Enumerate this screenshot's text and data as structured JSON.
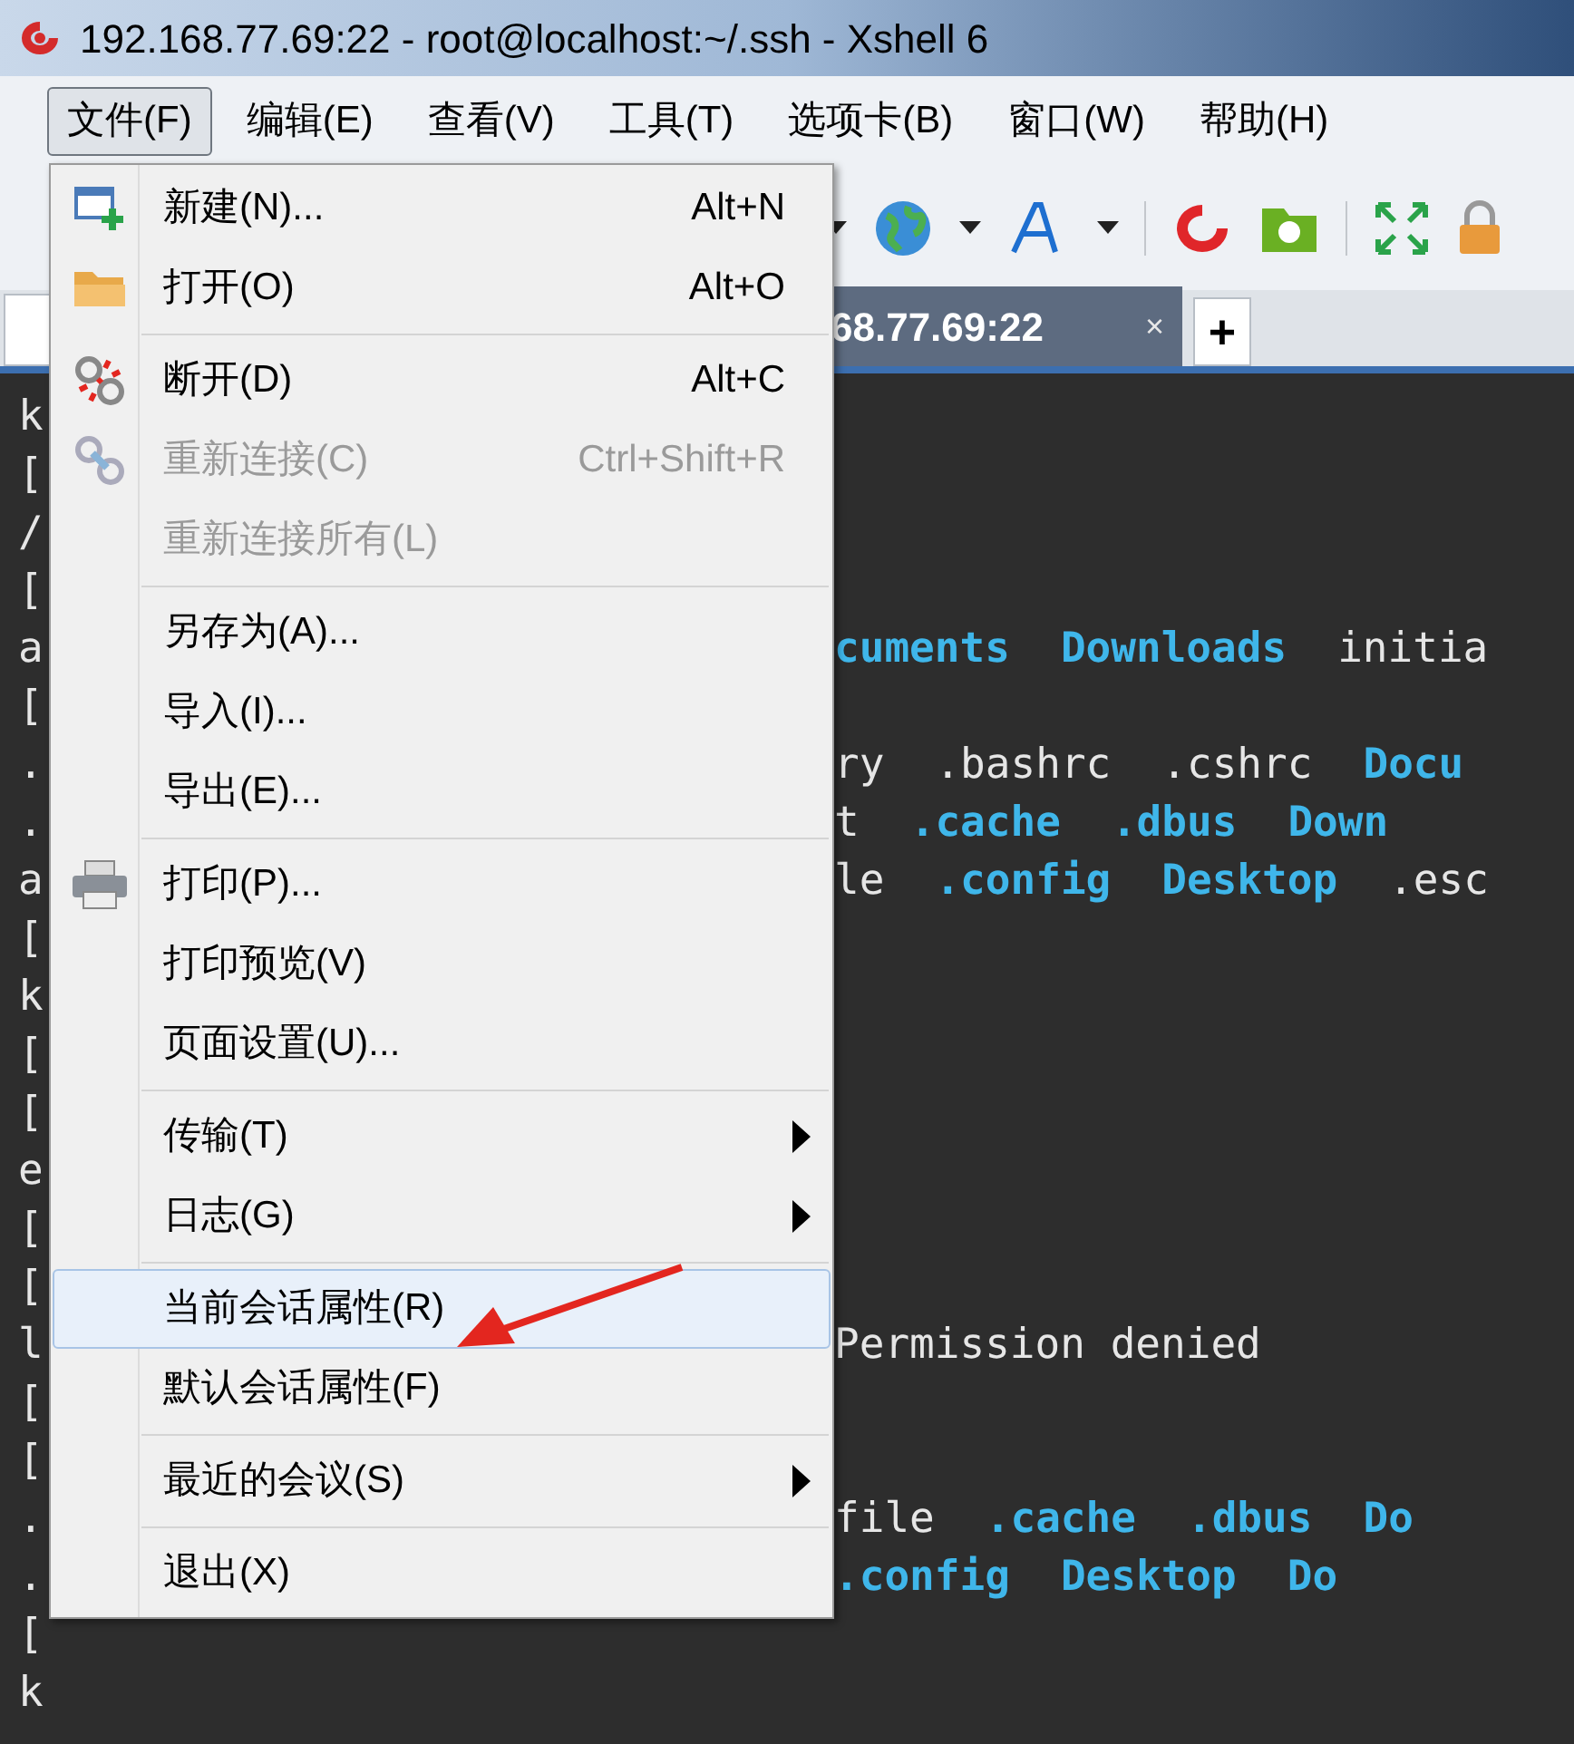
{
  "window": {
    "title": "192.168.77.69:22 - root@localhost:~/.ssh - Xshell 6"
  },
  "menubar": [
    {
      "label": "文件(F)",
      "selected": true
    },
    {
      "label": "编辑(E)",
      "selected": false
    },
    {
      "label": "查看(V)",
      "selected": false
    },
    {
      "label": "工具(T)",
      "selected": false
    },
    {
      "label": "选项卡(B)",
      "selected": false
    },
    {
      "label": "窗口(W)",
      "selected": false
    },
    {
      "label": "帮助(H)",
      "selected": false
    }
  ],
  "tabs": [
    {
      "label": "68.77.69:22",
      "close": "×",
      "selected": true
    }
  ],
  "new_tab": "+",
  "menu": {
    "groups": [
      [
        {
          "label": "新建(N)...",
          "shortcut": "Alt+N",
          "disabled": false,
          "submenu": false,
          "selected": false
        },
        {
          "label": "打开(O)",
          "shortcut": "Alt+O",
          "disabled": false,
          "submenu": false,
          "selected": false
        }
      ],
      [
        {
          "label": "断开(D)",
          "shortcut": "Alt+C",
          "disabled": false,
          "submenu": false,
          "selected": false
        },
        {
          "label": "重新连接(C)",
          "shortcut": "Ctrl+Shift+R",
          "disabled": true,
          "submenu": false,
          "selected": false
        },
        {
          "label": "重新连接所有(L)",
          "disabled": true,
          "submenu": false,
          "selected": false
        }
      ],
      [
        {
          "label": "另存为(A)...",
          "disabled": false,
          "submenu": false,
          "selected": false
        },
        {
          "label": "导入(I)...",
          "disabled": false,
          "submenu": false,
          "selected": false
        },
        {
          "label": "导出(E)...",
          "disabled": false,
          "submenu": false,
          "selected": false
        }
      ],
      [
        {
          "label": "打印(P)...",
          "disabled": false,
          "submenu": false,
          "selected": false
        },
        {
          "label": "打印预览(V)",
          "disabled": false,
          "submenu": false,
          "selected": false
        },
        {
          "label": "页面设置(U)...",
          "disabled": false,
          "submenu": false,
          "selected": false
        }
      ],
      [
        {
          "label": "传输(T)",
          "disabled": false,
          "submenu": true,
          "selected": false
        },
        {
          "label": "日志(G)",
          "disabled": false,
          "submenu": true,
          "selected": false
        }
      ],
      [
        {
          "label": "当前会话属性(R)",
          "disabled": false,
          "submenu": false,
          "selected": true
        },
        {
          "label": "默认会话属性(F)",
          "disabled": false,
          "submenu": false,
          "selected": false
        }
      ],
      [
        {
          "label": "最近的会议(S)",
          "disabled": false,
          "submenu": true,
          "selected": false
        }
      ],
      [
        {
          "label": "退出(X)",
          "disabled": false,
          "submenu": false,
          "selected": false
        }
      ]
    ]
  },
  "terminal": {
    "lines": [
      {
        "left": "k"
      },
      {
        "left": "["
      },
      {
        "left": "/"
      },
      {
        "left": "["
      },
      {
        "left": "a",
        "segments": [
          {
            "text": "cuments",
            "kind": "dir"
          },
          {
            "text": "Downloads",
            "kind": "dir"
          },
          {
            "text": "initia",
            "kind": "file"
          }
        ]
      },
      {
        "left": "["
      },
      {
        "left": ".",
        "segments": [
          {
            "text": "ry",
            "kind": "file"
          },
          {
            "text": ".bashrc",
            "kind": "file"
          },
          {
            "text": ".cshrc",
            "kind": "file"
          },
          {
            "text": "Docu",
            "kind": "dir"
          }
        ]
      },
      {
        "left": ".",
        "segments": [
          {
            "text": "t",
            "kind": "file"
          },
          {
            "text": ".cache",
            "kind": "dir"
          },
          {
            "text": ".dbus",
            "kind": "dir"
          },
          {
            "text": "Down",
            "kind": "dir"
          }
        ]
      },
      {
        "left": "a",
        "segments": [
          {
            "text": "le",
            "kind": "file"
          },
          {
            "text": ".config",
            "kind": "dir"
          },
          {
            "text": "Desktop",
            "kind": "dir"
          },
          {
            "text": ".esc",
            "kind": "file"
          }
        ]
      },
      {
        "left": "["
      },
      {
        "left": "k"
      },
      {
        "left": "["
      },
      {
        "left": "["
      },
      {
        "left": "e"
      },
      {
        "left": "["
      },
      {
        "left": "["
      },
      {
        "left": "l",
        "segments": [
          {
            "text": "Permission denied",
            "kind": "file"
          }
        ]
      },
      {
        "left": "["
      },
      {
        "left": "["
      },
      {
        "left": ".",
        "segments": [
          {
            "text": "file",
            "kind": "file"
          },
          {
            "text": ".cache",
            "kind": "dir"
          },
          {
            "text": ".dbus",
            "kind": "dir"
          },
          {
            "text": "Do",
            "kind": "dir"
          }
        ]
      },
      {
        "left": ".",
        "segments": [
          {
            "text": ".config",
            "kind": "dir"
          },
          {
            "text": "Desktop",
            "kind": "dir"
          },
          {
            "text": "Do",
            "kind": "dir"
          }
        ]
      },
      {
        "left": "["
      },
      {
        "left": "k"
      }
    ]
  }
}
